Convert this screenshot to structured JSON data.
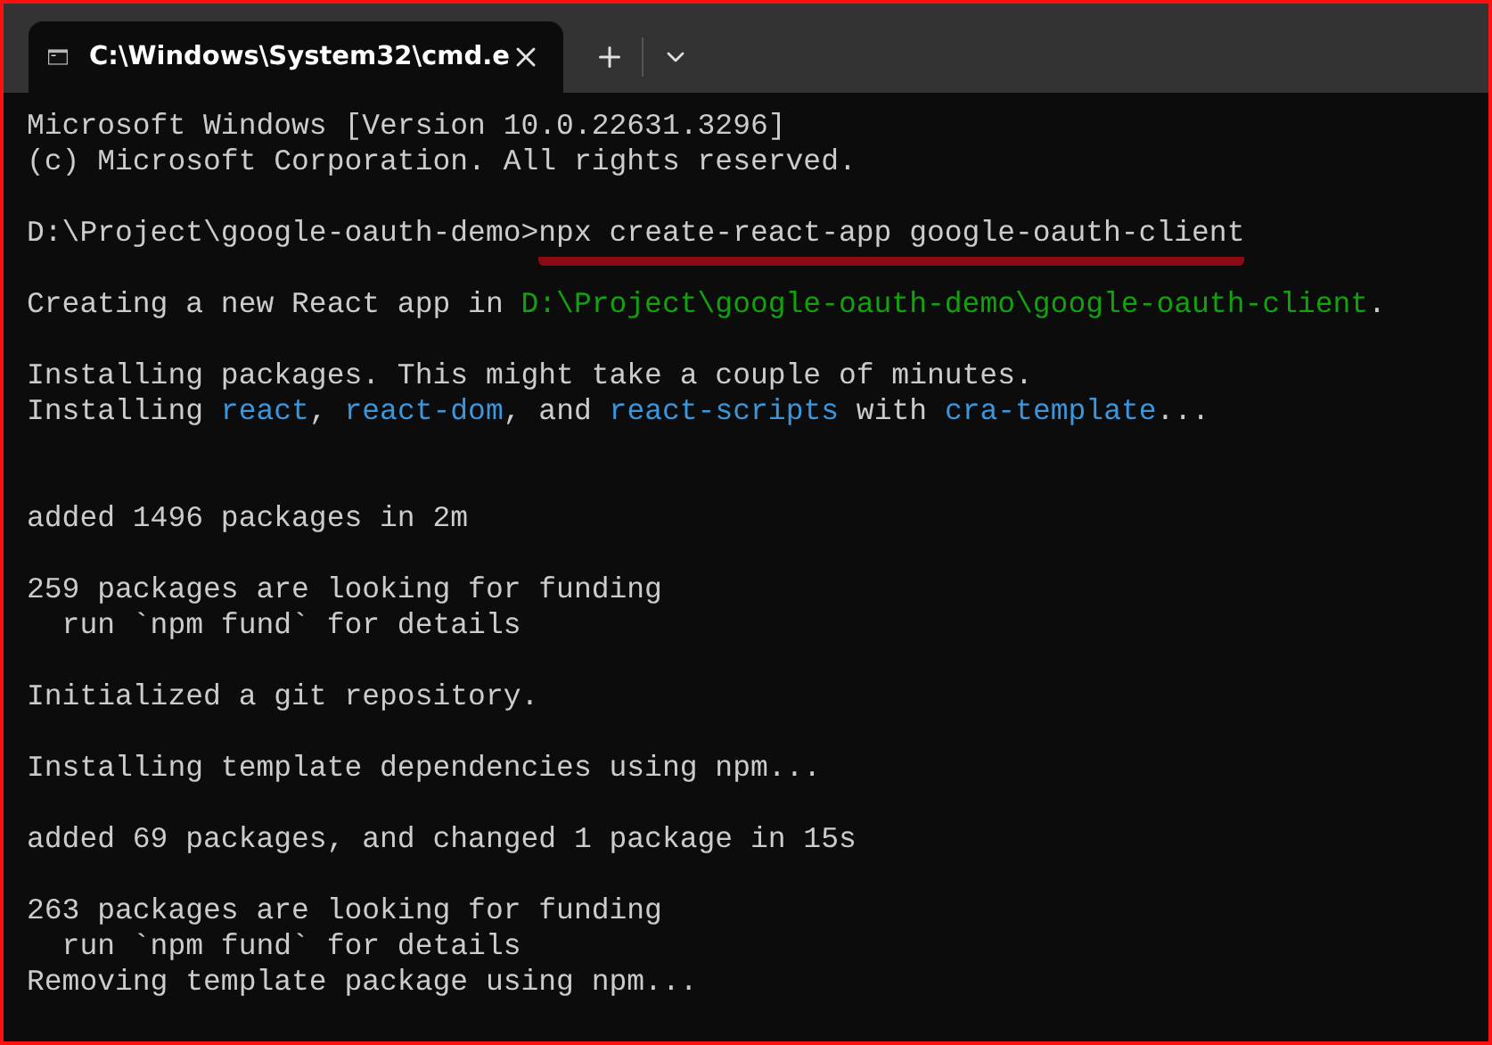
{
  "tab": {
    "title": "C:\\Windows\\System32\\cmd.e"
  },
  "lines": [
    {
      "kind": "text",
      "segments": [
        {
          "text": "Microsoft Windows [Version 10.0.22631.3296]",
          "kind": "plain"
        }
      ]
    },
    {
      "kind": "text",
      "segments": [
        {
          "text": "(c) Microsoft Corporation. All rights reserved.",
          "kind": "plain"
        }
      ]
    },
    {
      "kind": "blank"
    },
    {
      "kind": "text",
      "segments": [
        {
          "text": "D:\\Project\\google-oauth-demo>",
          "kind": "plain"
        },
        {
          "text": "npx create-react-app google-oauth-client",
          "kind": "plain",
          "underlined": true
        }
      ]
    },
    {
      "kind": "blank"
    },
    {
      "kind": "text",
      "segments": [
        {
          "text": "Creating a new React app in ",
          "kind": "plain"
        },
        {
          "text": "D:\\Project\\google-oauth-demo\\google-oauth-client",
          "kind": "path"
        },
        {
          "text": ".",
          "kind": "plain"
        }
      ]
    },
    {
      "kind": "blank"
    },
    {
      "kind": "text",
      "segments": [
        {
          "text": "Installing packages. This might take a couple of minutes.",
          "kind": "plain"
        }
      ]
    },
    {
      "kind": "text",
      "segments": [
        {
          "text": "Installing ",
          "kind": "plain"
        },
        {
          "text": "react",
          "kind": "package"
        },
        {
          "text": ", ",
          "kind": "plain"
        },
        {
          "text": "react-dom",
          "kind": "package"
        },
        {
          "text": ", and ",
          "kind": "plain"
        },
        {
          "text": "react-scripts",
          "kind": "package"
        },
        {
          "text": " with ",
          "kind": "plain"
        },
        {
          "text": "cra-template",
          "kind": "package"
        },
        {
          "text": "...",
          "kind": "plain"
        }
      ]
    },
    {
      "kind": "blank"
    },
    {
      "kind": "blank"
    },
    {
      "kind": "text",
      "segments": [
        {
          "text": "added 1496 packages in 2m",
          "kind": "plain"
        }
      ]
    },
    {
      "kind": "blank"
    },
    {
      "kind": "text",
      "segments": [
        {
          "text": "259 packages are looking for funding",
          "kind": "plain"
        }
      ]
    },
    {
      "kind": "text",
      "segments": [
        {
          "text": "  run `npm fund` for details",
          "kind": "plain"
        }
      ]
    },
    {
      "kind": "blank"
    },
    {
      "kind": "text",
      "segments": [
        {
          "text": "Initialized a git repository.",
          "kind": "plain"
        }
      ]
    },
    {
      "kind": "blank"
    },
    {
      "kind": "text",
      "segments": [
        {
          "text": "Installing template dependencies using npm...",
          "kind": "plain"
        }
      ]
    },
    {
      "kind": "blank"
    },
    {
      "kind": "text",
      "segments": [
        {
          "text": "added 69 packages, and changed 1 package in 15s",
          "kind": "plain"
        }
      ]
    },
    {
      "kind": "blank"
    },
    {
      "kind": "text",
      "segments": [
        {
          "text": "263 packages are looking for funding",
          "kind": "plain"
        }
      ]
    },
    {
      "kind": "text",
      "segments": [
        {
          "text": "  run `npm fund` for details",
          "kind": "plain"
        }
      ]
    },
    {
      "kind": "text",
      "segments": [
        {
          "text": "Removing template package using npm...",
          "kind": "plain"
        }
      ]
    }
  ]
}
